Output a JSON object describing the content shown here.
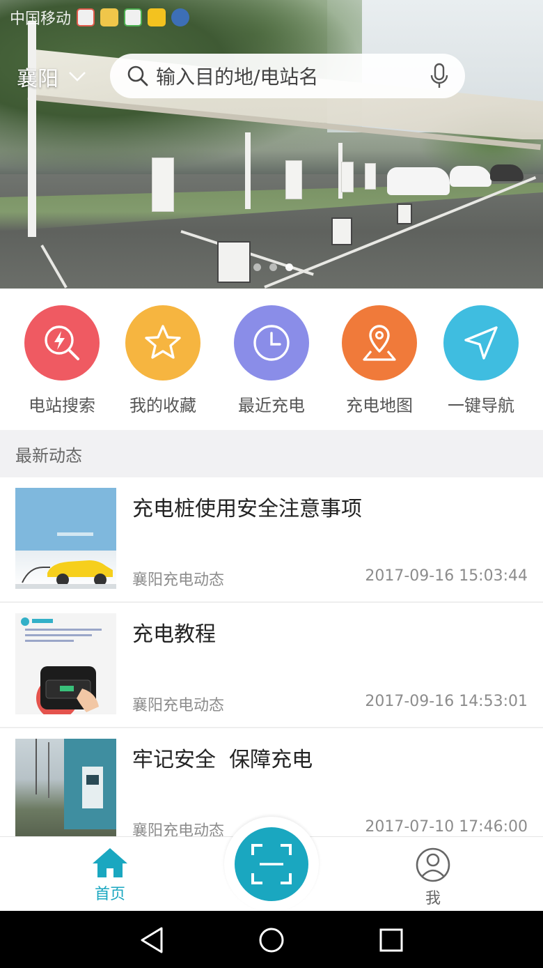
{
  "status_bar": {
    "carrier": "中国移动"
  },
  "header": {
    "city": "襄阳",
    "search": {
      "placeholder": "输入目的地/电站名"
    }
  },
  "banner": {
    "slides": 3,
    "active_slide": 1
  },
  "quick_menu": [
    {
      "label": "电站搜索",
      "icon": "station-search-icon",
      "color": "#ef5a62"
    },
    {
      "label": "我的收藏",
      "icon": "star-icon",
      "color": "#f6b540"
    },
    {
      "label": "最近充电",
      "icon": "clock-icon",
      "color": "#8a8de8"
    },
    {
      "label": "充电地图",
      "icon": "map-pin-icon",
      "color": "#f07a3a"
    },
    {
      "label": "一键导航",
      "icon": "navigation-arrow-icon",
      "color": "#3fbde0"
    }
  ],
  "news": {
    "section_title": "最新动态",
    "items": [
      {
        "title": "充电桩使用安全注意事项",
        "source": "襄阳充电动态",
        "time": "2017-09-16 15:03:44"
      },
      {
        "title": "充电教程",
        "source": "襄阳充电动态",
        "time": "2017-09-16 14:53:01"
      },
      {
        "title": "牢记安全  保障充电",
        "source": "襄阳充电动态",
        "time": "2017-07-10 17:46:00"
      }
    ]
  },
  "tabbar": {
    "home_label": "首页",
    "me_label": "我",
    "active_color": "#1aa7c0",
    "inactive_color": "#666666"
  }
}
